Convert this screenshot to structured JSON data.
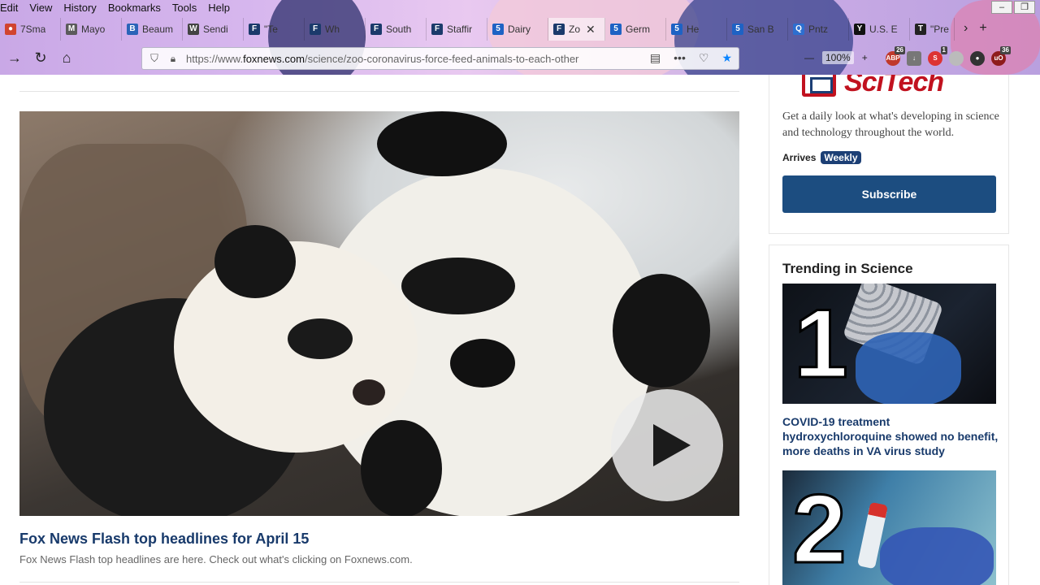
{
  "browser": {
    "menu": [
      "Edit",
      "View",
      "History",
      "Bookmarks",
      "Tools",
      "Help"
    ],
    "tabs": [
      {
        "label": "7Sma",
        "icon": "nbc-icon",
        "color": "#d1442f"
      },
      {
        "label": "Mayo",
        "icon": "mayo-icon",
        "color": "#5b5b5b"
      },
      {
        "label": "Beaum",
        "icon": "beaumont-icon",
        "color": "#2a64b8"
      },
      {
        "label": "Sendi",
        "icon": "wsj-icon",
        "color": "#444444"
      },
      {
        "label": "\"Te",
        "icon": "fox-icon",
        "color": "#1b3a6b"
      },
      {
        "label": "Wh",
        "icon": "fox-icon",
        "color": "#1b3a6b"
      },
      {
        "label": "South",
        "icon": "fox-icon",
        "color": "#1b3a6b"
      },
      {
        "label": "Staffir",
        "icon": "fox-icon",
        "color": "#1b3a6b"
      },
      {
        "label": "Dairy",
        "icon": "channel5-icon",
        "color": "#1e62c4"
      },
      {
        "label": "Zo",
        "icon": "fox-icon",
        "color": "#1b3a6b",
        "active": true
      },
      {
        "label": "Germ",
        "icon": "channel5-icon",
        "color": "#1e62c4"
      },
      {
        "label": "He",
        "icon": "channel5-icon",
        "color": "#1e62c4"
      },
      {
        "label": "San B",
        "icon": "channel5-icon",
        "color": "#1e62c4"
      },
      {
        "label": "Pntz",
        "icon": "q-icon",
        "color": "#2d6fd0"
      },
      {
        "label": "U.S. E",
        "icon": "yahoo-icon",
        "color": "#111111"
      },
      {
        "label": "\"Pre",
        "icon": "nyt-icon",
        "color": "#222222"
      }
    ],
    "tab_close": "✕",
    "url_prefix": "https://www.",
    "url_domain": "foxnews.com",
    "url_path": "/science/zoo-coronavirus-force-feed-animals-to-each-other",
    "zoom": "100%",
    "extension_badges": {
      "abp": "26",
      "ext2": "1",
      "ublock": "36"
    }
  },
  "article": {
    "video_title": "Fox News Flash top headlines for April 15",
    "video_description": "Fox News Flash top headlines are here. Check out what's clicking on Foxnews.com."
  },
  "newsletter": {
    "brand": "SciTech",
    "description": "Get a daily look at what's developing in science and technology throughout the world.",
    "arrives_label": "Arrives",
    "frequency": "Weekly",
    "subscribe_label": "Subscribe"
  },
  "trending": {
    "title": "Trending in Science",
    "items": [
      {
        "rank": "1",
        "caption": "COVID-19 treatment hydroxychloroquine showed no benefit, more deaths in VA virus study"
      },
      {
        "rank": "2",
        "caption": ""
      }
    ]
  },
  "colors": {
    "fox_blue": "#183a6b",
    "scitech_red": "#c1121f",
    "subscribe_blue": "#1c4d80",
    "firefox_star": "#0a84ff"
  }
}
